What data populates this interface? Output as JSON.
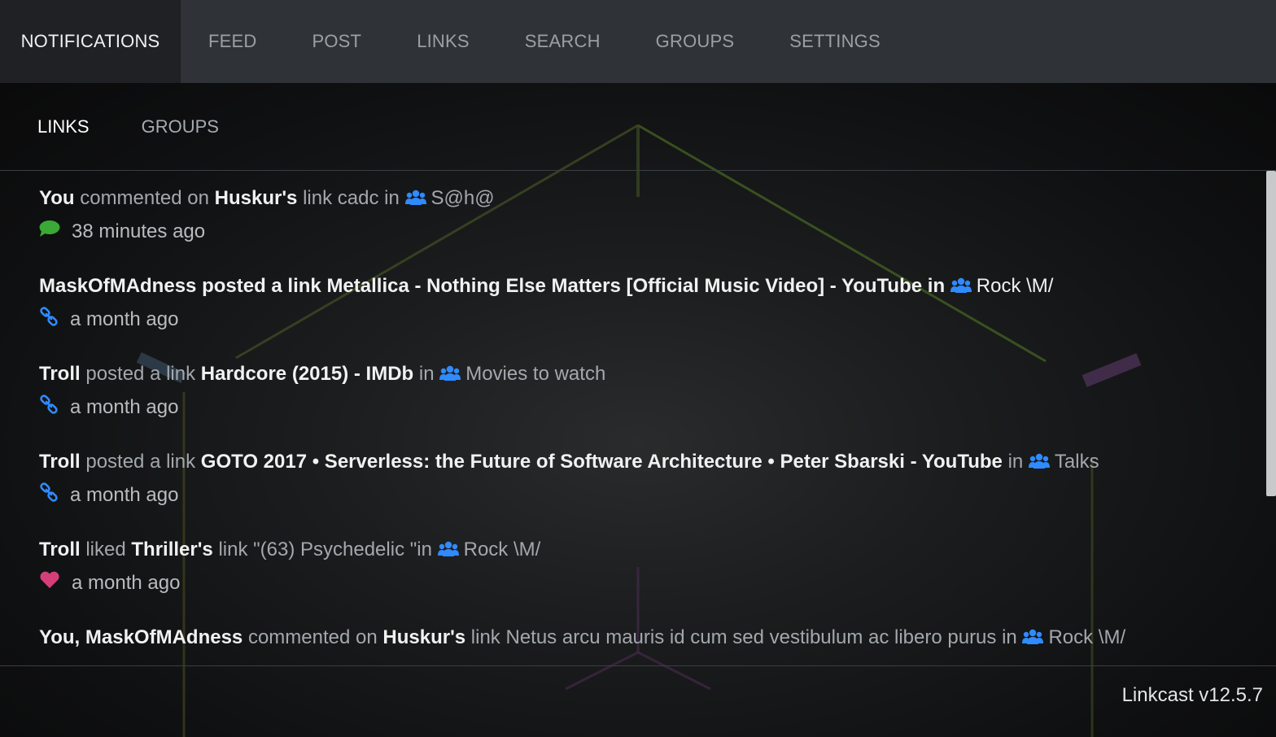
{
  "app_version": "Linkcast v12.5.7",
  "top_nav": {
    "tabs": [
      "NOTIFICATIONS",
      "FEED",
      "POST",
      "LINKS",
      "SEARCH",
      "GROUPS",
      "SETTINGS"
    ],
    "active": "NOTIFICATIONS"
  },
  "sub_nav": {
    "tabs": [
      "LINKS",
      "GROUPS"
    ],
    "active": "LINKS"
  },
  "colors": {
    "group_icon": "#2f8bff",
    "comment_icon": "#3aa935",
    "link_icon": "#2f8bff",
    "heart_icon": "#d43f7a"
  },
  "notifications": [
    {
      "actor": "You",
      "action": "commented on",
      "owner": "Huskur's",
      "link_word": "link",
      "title": "cadc",
      "in_word": "in",
      "group": "S@h@",
      "icon": "comment-icon",
      "time": "38 minutes ago"
    },
    {
      "actor": "MaskOfMAdness",
      "action": "posted a link",
      "title": "Metallica - Nothing Else Matters [Official Music Video] - YouTube",
      "in_word": "in",
      "group": "Rock \\M/",
      "icon": "link-icon",
      "time": "a month ago"
    },
    {
      "actor": "Troll",
      "action": "posted a link",
      "title": "Hardcore (2015) - IMDb",
      "in_word": "in",
      "group": "Movies to watch",
      "icon": "link-icon",
      "time": "a month ago"
    },
    {
      "actor": "Troll",
      "action": "posted a link",
      "title": "GOTO 2017 • Serverless: the Future of Software Architecture • Peter Sbarski - YouTube",
      "in_word": "in",
      "group": "Talks",
      "icon": "link-icon",
      "time": "a month ago"
    },
    {
      "actor": "Troll",
      "action": "liked",
      "owner": "Thriller's",
      "link_word": "link",
      "title": "\"(63) Psychedelic \"",
      "in_word": "in",
      "group": "Rock \\M/",
      "icon": "heart-icon",
      "time": "a month ago"
    },
    {
      "actor": "You, MaskOfMAdness",
      "action": "commented on",
      "owner": "Huskur's",
      "link_word": "link",
      "title": "Netus arcu mauris id cum sed vestibulum ac libero purus",
      "in_word": "in",
      "group": "Rock \\M/"
    }
  ]
}
